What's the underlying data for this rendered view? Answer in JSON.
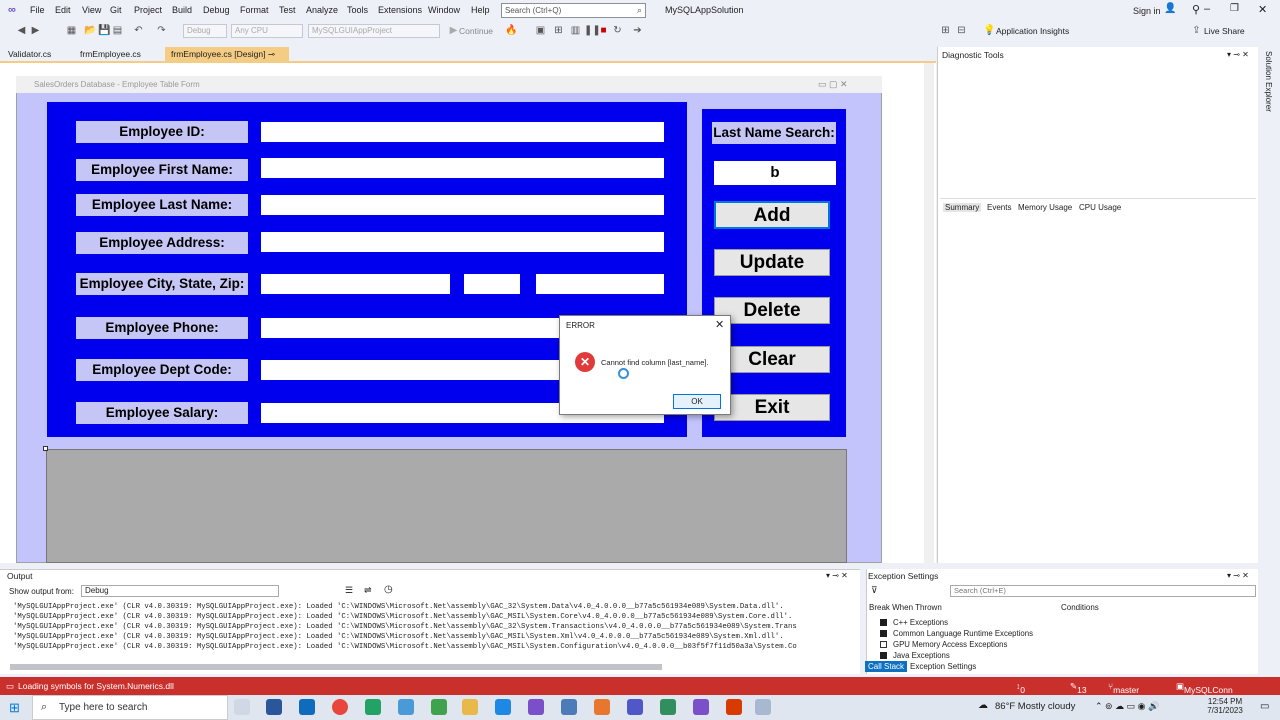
{
  "menu": [
    "File",
    "Edit",
    "View",
    "Git",
    "Project",
    "Build",
    "Debug",
    "Format",
    "Test",
    "Analyze",
    "Tools",
    "Extensions",
    "Window",
    "Help"
  ],
  "search": {
    "placeholder": "Search (Ctrl+Q)"
  },
  "solution_name": "MySQLAppSolution",
  "sign_in": "Sign in",
  "toolbar": {
    "config": "Debug",
    "platform": "Any CPU",
    "project": "MySQLGUIAppProject",
    "continue": "Continue",
    "app_insights": "Application Insights",
    "live_share": "Live Share"
  },
  "tabs": [
    "Validator.cs",
    "frmEmployee.cs",
    "frmEmployee.cs [Design]"
  ],
  "form": {
    "title": "SalesOrders Database - Employee Table Form",
    "labels": {
      "id": "Employee ID:",
      "first": "Employee First Name:",
      "last": "Employee Last Name:",
      "address": "Employee Address:",
      "csz": "Employee City, State, Zip:",
      "phone": "Employee Phone:",
      "dept": "Employee Dept Code:",
      "salary": "Employee Salary:"
    },
    "search_label": "Last Name Search:",
    "search_value": "b",
    "buttons": {
      "add": "Add",
      "update": "Update",
      "delete": "Delete",
      "clear": "Clear",
      "exit": "Exit"
    }
  },
  "dialog": {
    "title": "ERROR",
    "message": "Cannot find column [last_name].",
    "ok": "OK"
  },
  "diagnostic": {
    "title": "Diagnostic Tools",
    "tabs": [
      "Summary",
      "Events",
      "Memory Usage",
      "CPU Usage"
    ]
  },
  "side_tab": "Solution Explorer",
  "output": {
    "title": "Output",
    "show_from": "Show output from:",
    "source": "Debug",
    "lines": [
      "'MySQLGUIAppProject.exe' (CLR v4.0.30319: MySQLGUIAppProject.exe): Loaded 'C:\\WINDOWS\\Microsoft.Net\\assembly\\GAC_32\\System.Data\\v4.0_4.0.0.0__b77a5c561934e089\\System.Data.dll'.",
      "'MySQLGUIAppProject.exe' (CLR v4.0.30319: MySQLGUIAppProject.exe): Loaded 'C:\\WINDOWS\\Microsoft.Net\\assembly\\GAC_MSIL\\System.Core\\v4.0_4.0.0.0__b77a5c561934e089\\System.Core.dll'.",
      "'MySQLGUIAppProject.exe' (CLR v4.0.30319: MySQLGUIAppProject.exe): Loaded 'C:\\WINDOWS\\Microsoft.Net\\assembly\\GAC_32\\System.Transactions\\v4.0_4.0.0.0__b77a5c561934e089\\System.Trans",
      "'MySQLGUIAppProject.exe' (CLR v4.0.30319: MySQLGUIAppProject.exe): Loaded 'C:\\WINDOWS\\Microsoft.Net\\assembly\\GAC_MSIL\\System.Xml\\v4.0_4.0.0.0__b77a5c561934e089\\System.Xml.dll'.",
      "'MySQLGUIAppProject.exe' (CLR v4.0.30319: MySQLGUIAppProject.exe): Loaded 'C:\\WINDOWS\\Microsoft.Net\\assembly\\GAC_MSIL\\System.Configuration\\v4.0_4.0.0.0__b03f5f7f11d50a3a\\System.Co"
    ]
  },
  "exceptions": {
    "title": "Exception Settings",
    "search": "Search (Ctrl+E)",
    "col_break": "Break When Thrown",
    "col_cond": "Conditions",
    "rows": [
      "C++ Exceptions",
      "Common Language Runtime Exceptions",
      "GPU Memory Access Exceptions",
      "Java Exceptions"
    ]
  },
  "bottom_tabs": [
    "Call Stack",
    "Exception Settings"
  ],
  "status": {
    "left": "Loading symbols for System.Numerics.dll",
    "errors": "0 / 0",
    "changes": "13",
    "branch": "master",
    "repo": "MySQLConn"
  },
  "taskbar": {
    "search": "Type here to search",
    "weather": "86°F  Mostly cloudy",
    "time": "12:54 PM",
    "date": "7/31/2023"
  },
  "colors": {
    "panel": "#0000ee",
    "form_bg": "#c4c4fc",
    "status": "#c9302c",
    "tab_active": "#f5cc84"
  }
}
